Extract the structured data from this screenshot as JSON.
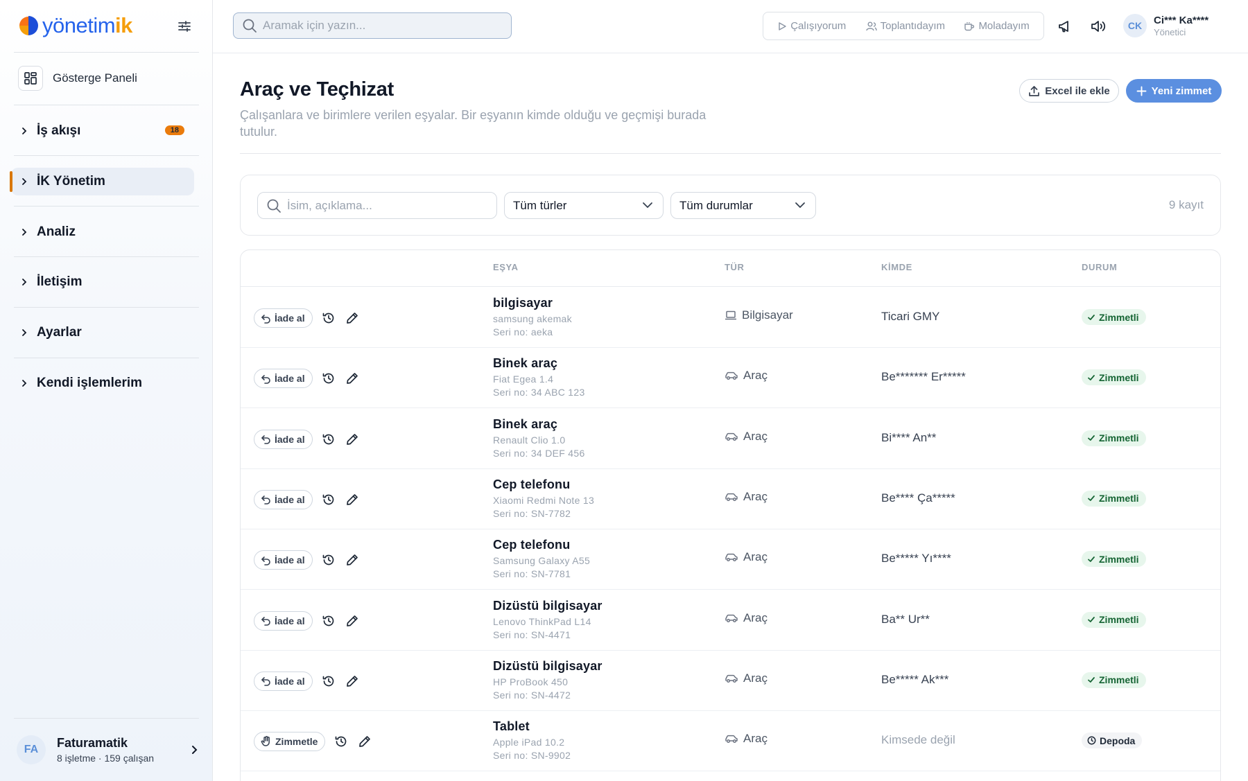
{
  "brand": {
    "name_part1": "yönetim",
    "name_part2": "ik"
  },
  "sidebar": {
    "dashboard_label": "Gösterge Paneli",
    "items": [
      {
        "label": "İş akışı",
        "badge": "18"
      },
      {
        "label": "İK Yönetim"
      },
      {
        "label": "Analiz"
      },
      {
        "label": "İletişim"
      },
      {
        "label": "Ayarlar"
      },
      {
        "label": "Kendi işlemlerim"
      }
    ],
    "active_index": 1,
    "org": {
      "avatar": "FA",
      "name": "Faturamatik",
      "sub": "8 işletme · 159 çalışan"
    }
  },
  "topbar": {
    "search_placeholder": "Aramak için yazın...",
    "status": [
      "Çalışıyorum",
      "Toplantıdayım",
      "Moladayım"
    ],
    "user": {
      "initials": "CK",
      "name": "Ci*** Ka****",
      "role": "Yönetici"
    }
  },
  "page": {
    "title": "Araç ve Teçhizat",
    "description": "Çalışanlara ve birimlere verilen eşyalar. Bir eşyanın kimde olduğu ve geçmişi burada tutulur.",
    "excel_button": "Excel ile ekle",
    "new_button": "Yeni zimmet"
  },
  "filters": {
    "search_placeholder": "İsim, açıklama...",
    "type_select": "Tüm türler",
    "status_select": "Tüm durumlar",
    "count": "9 kayıt"
  },
  "table": {
    "headers": [
      "EŞYA",
      "TÜR",
      "KİMDE",
      "DURUM"
    ],
    "rows": [
      {
        "action": "İade al",
        "name": "bilgisayar",
        "desc": "samsung akemak",
        "serial": "Seri no: aeka",
        "type": "Bilgisayar",
        "type_icon": "laptop-icon",
        "holder": "Ticari GMY",
        "status": "Zimmetli"
      },
      {
        "action": "İade al",
        "name": "Binek araç",
        "desc": "Fiat Egea 1.4",
        "serial": "Seri no: 34 ABC 123",
        "type": "Araç",
        "type_icon": "car-icon",
        "holder": "Be******* Er*****",
        "status": "Zimmetli"
      },
      {
        "action": "İade al",
        "name": "Binek araç",
        "desc": "Renault Clio 1.0",
        "serial": "Seri no: 34 DEF 456",
        "type": "Araç",
        "type_icon": "car-icon",
        "holder": "Bi**** An**",
        "status": "Zimmetli"
      },
      {
        "action": "İade al",
        "name": "Cep telefonu",
        "desc": "Xiaomi Redmi Note 13",
        "serial": "Seri no: SN-7782",
        "type": "Araç",
        "type_icon": "car-icon",
        "holder": "Be**** Ça*****",
        "status": "Zimmetli"
      },
      {
        "action": "İade al",
        "name": "Cep telefonu",
        "desc": "Samsung Galaxy A55",
        "serial": "Seri no: SN-7781",
        "type": "Araç",
        "type_icon": "car-icon",
        "holder": "Be***** Yı****",
        "status": "Zimmetli"
      },
      {
        "action": "İade al",
        "name": "Dizüstü bilgisayar",
        "desc": "Lenovo ThinkPad L14",
        "serial": "Seri no: SN-4471",
        "type": "Araç",
        "type_icon": "car-icon",
        "holder": "Ba** Ur**",
        "status": "Zimmetli"
      },
      {
        "action": "İade al",
        "name": "Dizüstü bilgisayar",
        "desc": "HP ProBook 450",
        "serial": "Seri no: SN-4472",
        "type": "Araç",
        "type_icon": "car-icon",
        "holder": "Be***** Ak***",
        "status": "Zimmetli"
      },
      {
        "action": "Zimmetle",
        "name": "Tablet",
        "desc": "Apple iPad 10.2",
        "serial": "Seri no: SN-9902",
        "type": "Araç",
        "type_icon": "car-icon",
        "holder": "Kimsede değil",
        "status": "Depoda"
      }
    ]
  },
  "colors": {
    "accent": "#5b8fe0",
    "brand_orange": "#f59e0b",
    "success_bg": "#e7f6ec",
    "success_text": "#166534"
  }
}
